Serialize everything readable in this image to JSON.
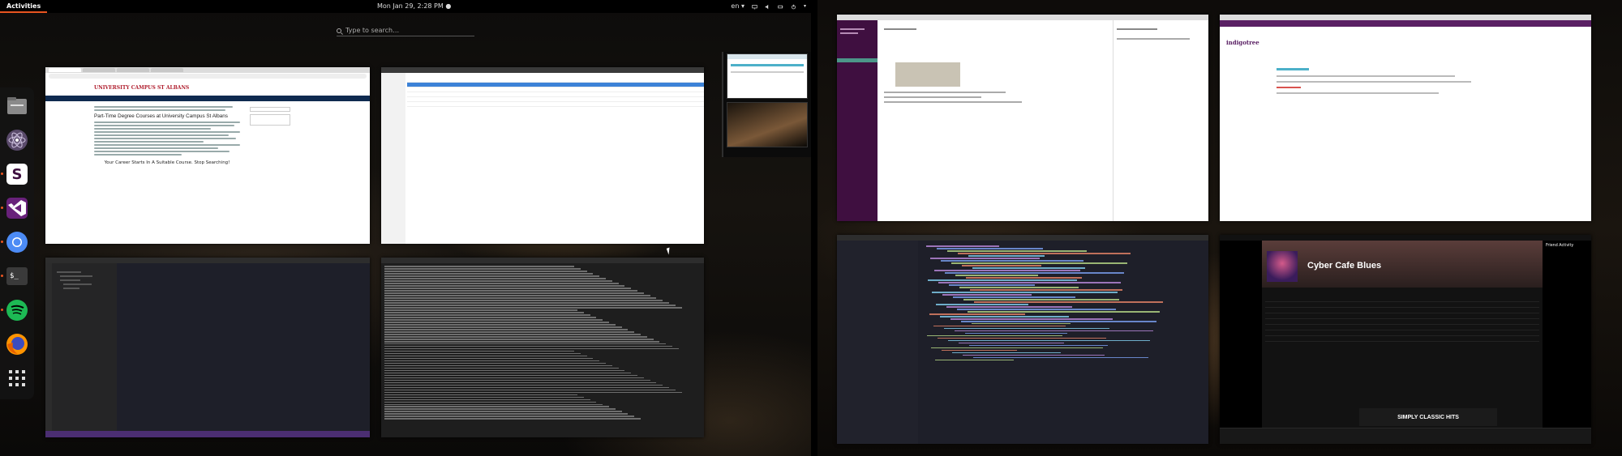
{
  "topbar": {
    "activities": "Activities",
    "clock": "Mon Jan 29,  2:28 PM ●",
    "language": "en ▾"
  },
  "search": {
    "placeholder": "Type to search…"
  },
  "dash": {
    "apps": [
      {
        "name": "files",
        "icon": "files-icon"
      },
      {
        "name": "atom",
        "icon": "atom-icon"
      },
      {
        "name": "slack",
        "icon": "slack-icon"
      },
      {
        "name": "visual-studio-code",
        "icon": "vscode-icon"
      },
      {
        "name": "chromium",
        "icon": "chromium-icon"
      },
      {
        "name": "terminal",
        "icon": "terminal-icon"
      },
      {
        "name": "spotify",
        "icon": "spotify-icon"
      },
      {
        "name": "firefox",
        "icon": "firefox-icon"
      },
      {
        "name": "show-applications",
        "icon": "grid-icon"
      }
    ]
  },
  "windows": {
    "chrome": {
      "logo": "UNIVERSITY CAMPUS ST ALBANS",
      "headline": "Part-Time Degree Courses at University Campus St Albans",
      "tagline": "Your Career Starts In A Suitable Course. Stop Searching!"
    },
    "spotify": {
      "playlist_title": "Cyber Cafe Blues",
      "friend_activity": "Friend Activity",
      "ad_brand": "SIMPLY CLASSIC HITS"
    },
    "indigo": {
      "logo": "indigotree"
    }
  },
  "colors": {
    "accent": "#e95420",
    "slack_sidebar": "#3f0f40",
    "indigo_header": "#5a2064",
    "spotify_bg": "#121212"
  }
}
